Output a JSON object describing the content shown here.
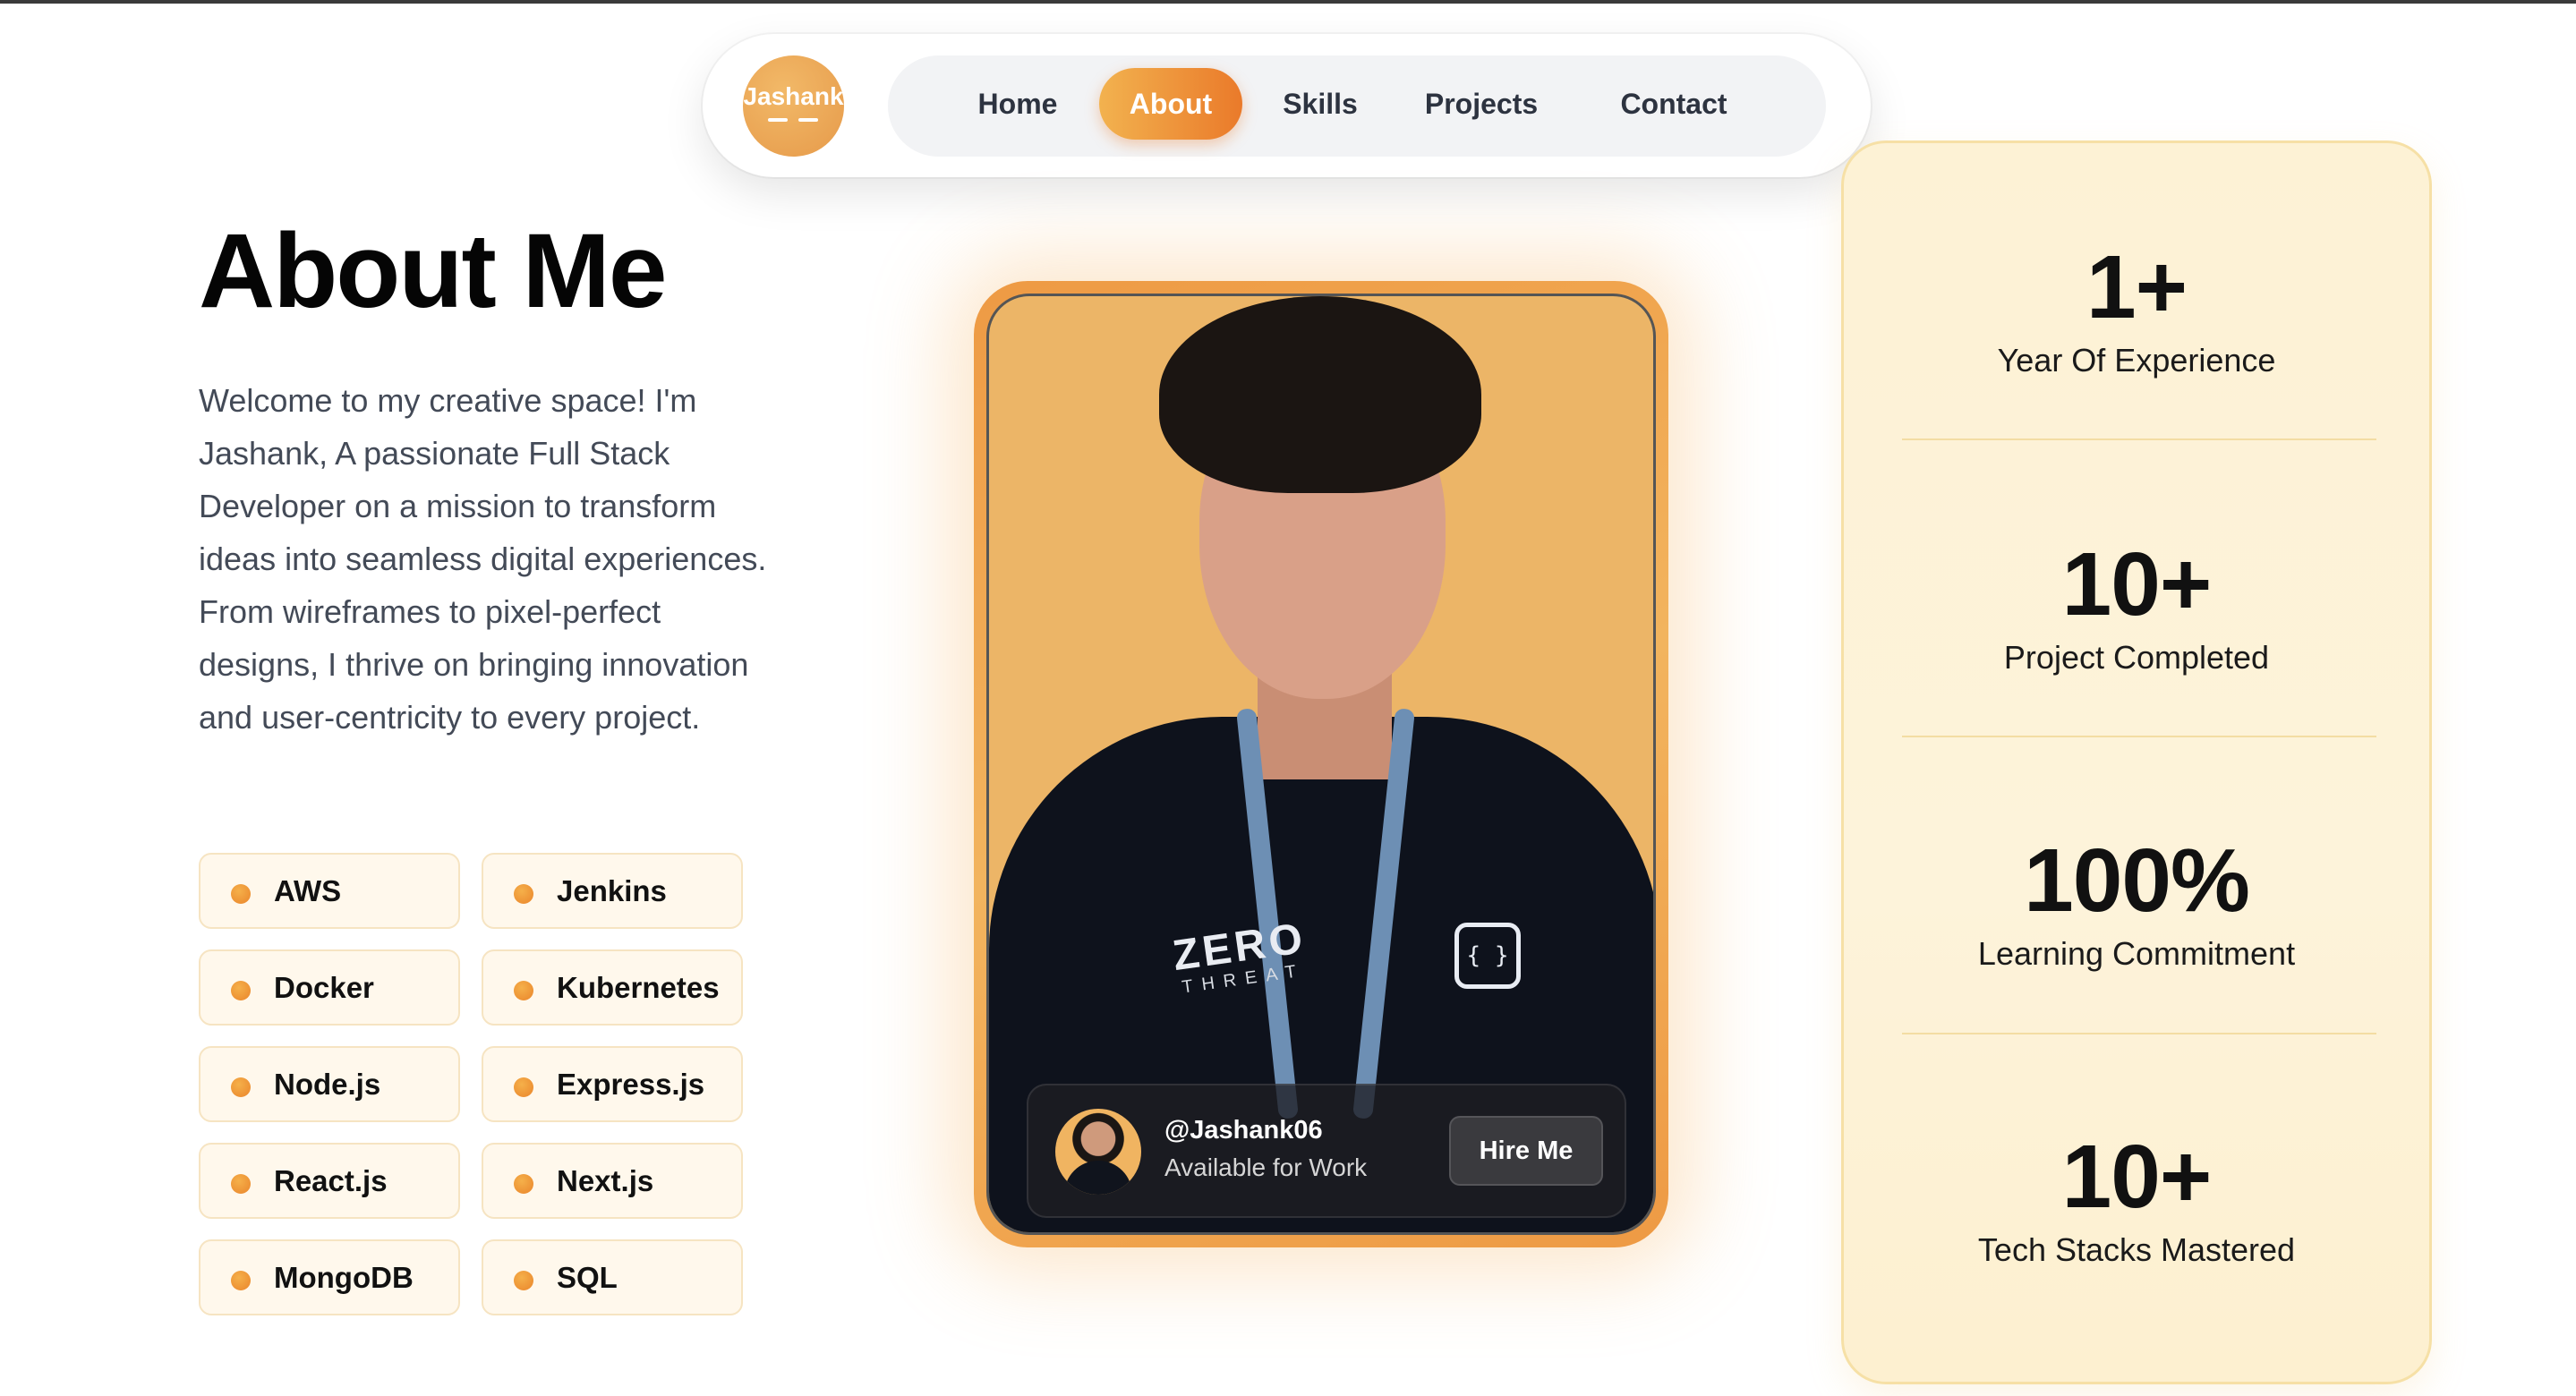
{
  "nav": {
    "logo_text": "Jashank",
    "items": [
      {
        "label": "Home",
        "active": false
      },
      {
        "label": "About",
        "active": true
      },
      {
        "label": "Skills",
        "active": false
      },
      {
        "label": "Projects",
        "active": false
      },
      {
        "label": "Contact",
        "active": false
      }
    ]
  },
  "about": {
    "title": "About Me",
    "intro": "Welcome to my creative space! I'm Jashank, A passionate Full Stack Developer on a mission to transform ideas into seamless digital experiences. From wireframes to pixel-perfect designs, I thrive on bringing innovation and user-centricity to every project.",
    "tags": [
      "AWS",
      "Jenkins",
      "Docker",
      "Kubernetes",
      "Node.js",
      "Express.js",
      "React.js",
      "Next.js",
      "MongoDB",
      "SQL"
    ]
  },
  "photo": {
    "shirt_brand": "ZERO",
    "shirt_sub": "THREAT",
    "handle": "@Jashank06",
    "availability": "Available for Work",
    "hire_label": "Hire Me"
  },
  "stats": [
    {
      "value": "1+",
      "label": "Year Of Experience"
    },
    {
      "value": "10+",
      "label": "Project Completed"
    },
    {
      "value": "100%",
      "label": "Learning Commitment"
    },
    {
      "value": "10+",
      "label": "Tech Stacks Mastered"
    }
  ],
  "colors": {
    "accent_start": "#f2b24f",
    "accent_end": "#ea7a2a",
    "stats_bg": "#fdf2d5",
    "tag_bg": "#fff8ec"
  }
}
